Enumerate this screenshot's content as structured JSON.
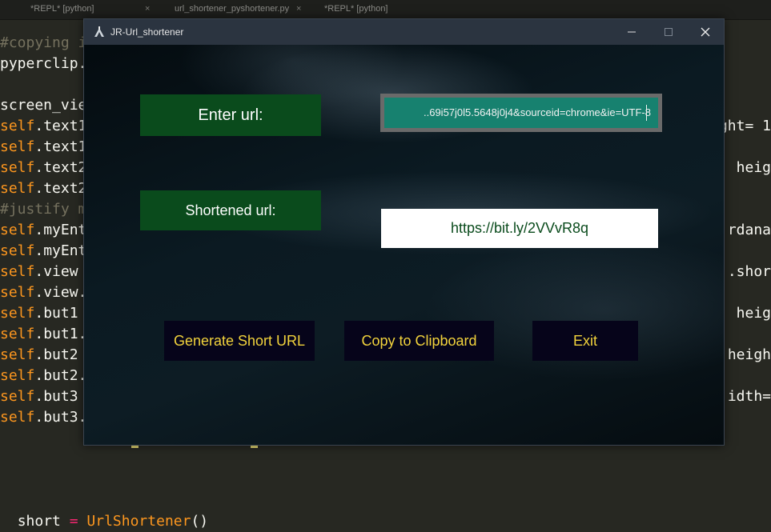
{
  "editor": {
    "tabs": [
      {
        "label": "*REPL* [python]",
        "close": "×"
      },
      {
        "label": "url_shortener_pyshortener.py",
        "close": "×"
      },
      {
        "label": "*REPL* [python]",
        "close": ""
      }
    ],
    "lines_left": [
      {
        "pre": "",
        "self": "",
        "rest": "",
        "comment": "#copying i"
      },
      {
        "pre": "pyperclip.",
        "self": "",
        "rest": "",
        "comment": ""
      },
      {
        "pre": "",
        "self": "",
        "rest": "",
        "comment": ""
      },
      {
        "pre": "screen_vie",
        "self": "",
        "rest": "",
        "comment": ""
      },
      {
        "pre": "",
        "self": "self",
        "rest": ".text1",
        "comment": ""
      },
      {
        "pre": "",
        "self": "self",
        "rest": ".text1",
        "comment": ""
      },
      {
        "pre": "",
        "self": "self",
        "rest": ".text2",
        "comment": ""
      },
      {
        "pre": "",
        "self": "self",
        "rest": ".text2",
        "comment": ""
      },
      {
        "pre": "",
        "self": "",
        "rest": "",
        "comment": "#justify m"
      },
      {
        "pre": "",
        "self": "self",
        "rest": ".myEnt",
        "comment": ""
      },
      {
        "pre": "",
        "self": "self",
        "rest": ".myEnt",
        "comment": ""
      },
      {
        "pre": "",
        "self": "self",
        "rest": ".view",
        "comment": ""
      },
      {
        "pre": "",
        "self": "self",
        "rest": ".view.",
        "comment": ""
      },
      {
        "pre": "",
        "self": "self",
        "rest": ".but1",
        "comment": ""
      },
      {
        "pre": "",
        "self": "self",
        "rest": ".but1.",
        "comment": ""
      },
      {
        "pre": "",
        "self": "self",
        "rest": ".but2",
        "comment": ""
      },
      {
        "pre": "",
        "self": "self",
        "rest": ".but2.",
        "comment": ""
      },
      {
        "pre": "",
        "self": "self",
        "rest": ".but3",
        "comment": ""
      },
      {
        "pre": "",
        "self": "self",
        "rest": ".but3.",
        "comment": ""
      }
    ],
    "lines_right": [
      {
        "line": 4,
        "text": "ght= 1"
      },
      {
        "line": 6,
        "text": " heig"
      },
      {
        "line": 9,
        "text": "rdana"
      },
      {
        "line": 11,
        "text": ".shor"
      },
      {
        "line": 13,
        "text": " heig"
      },
      {
        "line": 15,
        "text": "heigh"
      },
      {
        "line": 17,
        "text": "idth="
      }
    ],
    "last_line": {
      "var": "short",
      "op": "=",
      "call": "UrlShortener",
      "parens": "()"
    }
  },
  "app": {
    "title": "JR-Url_shortener",
    "enter_label": "Enter url:",
    "url_value": "..69i57j0l5.5648j0j4&sourceid=chrome&ie=UTF-8",
    "shortened_label": "Shortened url:",
    "short_url": "https://bit.ly/2VVvR8q",
    "buttons": {
      "generate": "Generate Short URL",
      "copy": "Copy to Clipboard",
      "exit": "Exit"
    },
    "colors": {
      "label_bg": "#0a4b1c",
      "input_bg": "#17816f",
      "button_text": "#f2d33c",
      "button_bg": "#06041a"
    }
  }
}
